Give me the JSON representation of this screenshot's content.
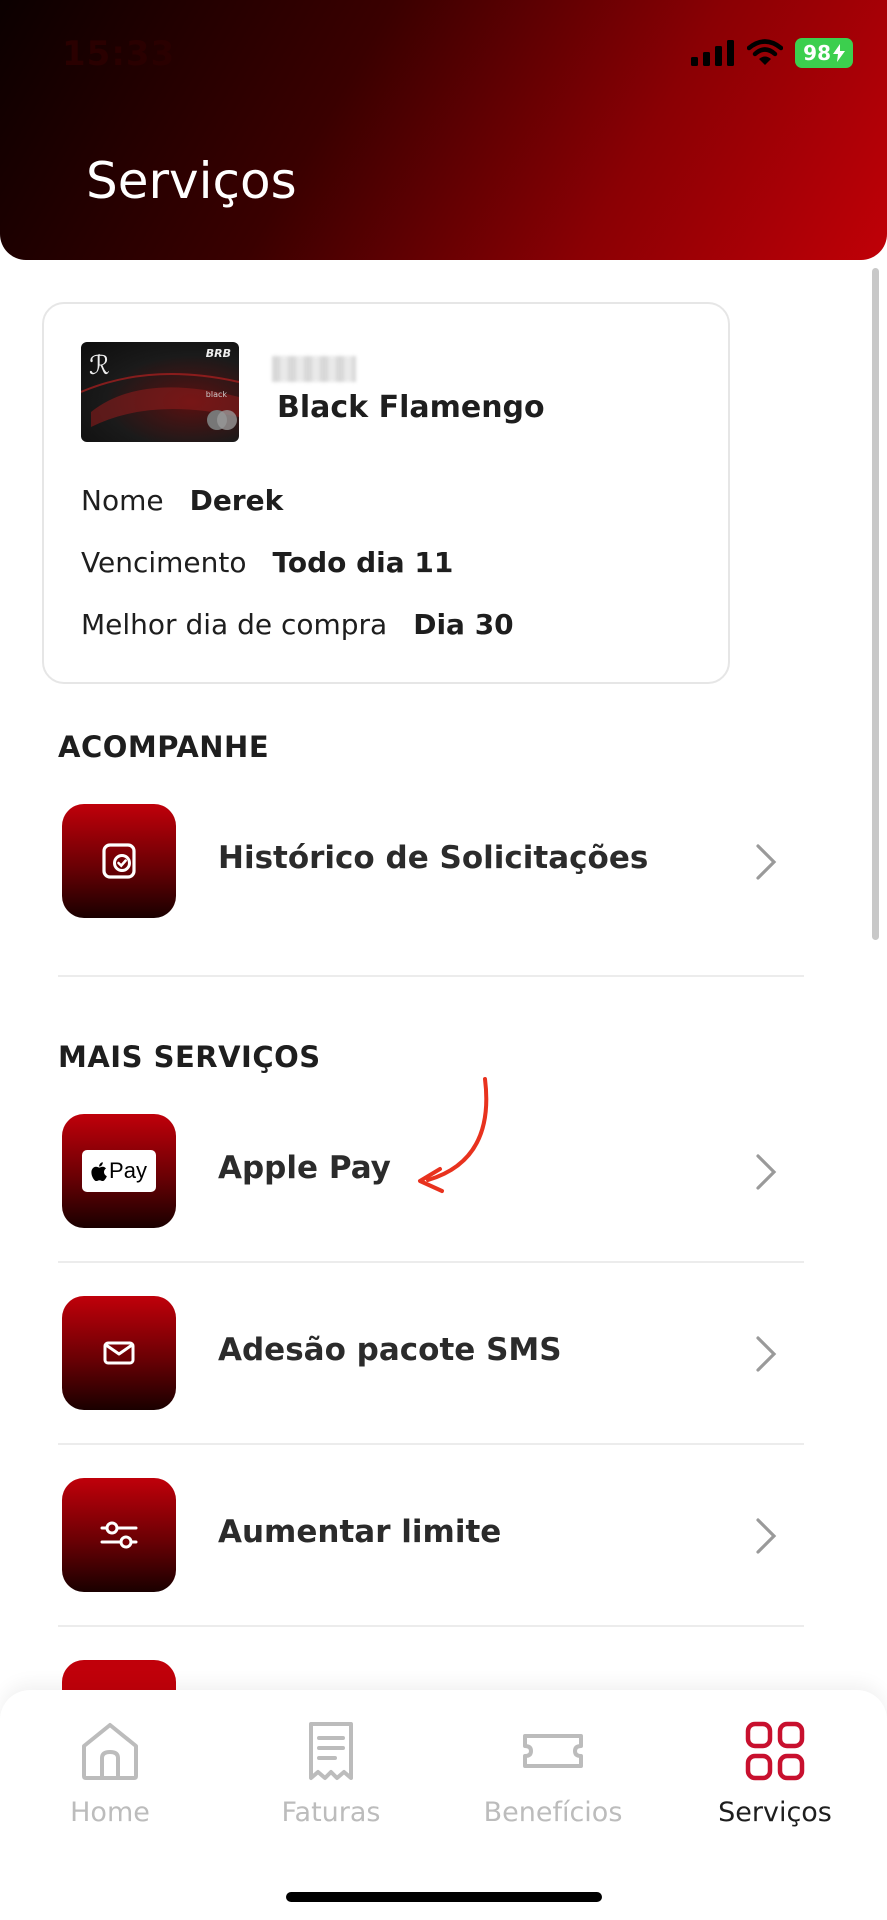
{
  "status_bar": {
    "time": "15:33",
    "battery": "98"
  },
  "header": {
    "title": "Serviços"
  },
  "card": {
    "brand": "BRB",
    "tier_text": "black",
    "name": "Black Flamengo",
    "rows": [
      {
        "label": "Nome",
        "value": "Derek"
      },
      {
        "label": "Vencimento",
        "value": "Todo dia 11"
      },
      {
        "label": "Melhor dia de compra",
        "value": "Dia 30"
      }
    ]
  },
  "sections": {
    "acompanhe": {
      "title": "ACOMPANHE",
      "items": [
        {
          "label": "Histórico de Solicitações",
          "icon": "request-history-icon"
        }
      ]
    },
    "mais_servicos": {
      "title": "MAIS SERVIÇOS",
      "items": [
        {
          "label": "Apple Pay",
          "icon": "apple-pay-icon",
          "badge": "Pay"
        },
        {
          "label": "Adesão pacote SMS",
          "icon": "envelope-icon"
        },
        {
          "label": "Aumentar limite",
          "icon": "sliders-icon"
        }
      ]
    }
  },
  "bottom_nav": {
    "items": [
      {
        "label": "Home",
        "icon": "home-icon"
      },
      {
        "label": "Faturas",
        "icon": "receipt-icon"
      },
      {
        "label": "Benefícios",
        "icon": "ticket-icon"
      },
      {
        "label": "Serviços",
        "icon": "grid-icon",
        "active": true
      }
    ]
  },
  "colors": {
    "accent": "#c8102e",
    "header_dark": "#0b0000",
    "header_red": "#c00007",
    "annotation_arrow": "#e8321e"
  }
}
